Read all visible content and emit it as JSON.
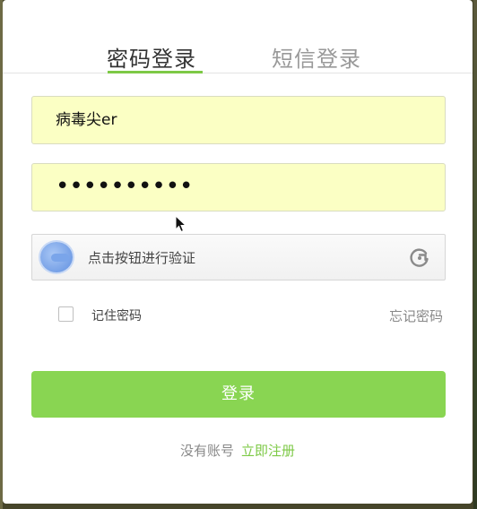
{
  "tabs": {
    "password_login": "密码登录",
    "sms_login": "短信登录"
  },
  "form": {
    "username_value": "病毒尖er",
    "password_mask": "••••••••••",
    "captcha_label": "点击按钮进行验证",
    "remember_label": "记住密码",
    "forgot_label": "忘记密码",
    "login_button": "登录",
    "signup_prefix": "没有账号",
    "signup_link": "立即注册"
  },
  "colors": {
    "accent": "#7dc946",
    "button": "#89d552",
    "autofill": "#fbffc4"
  },
  "icons": {
    "captcha": "captcha-knob-icon",
    "refresh": "refresh-icon",
    "cursor": "mouse-cursor-icon"
  }
}
